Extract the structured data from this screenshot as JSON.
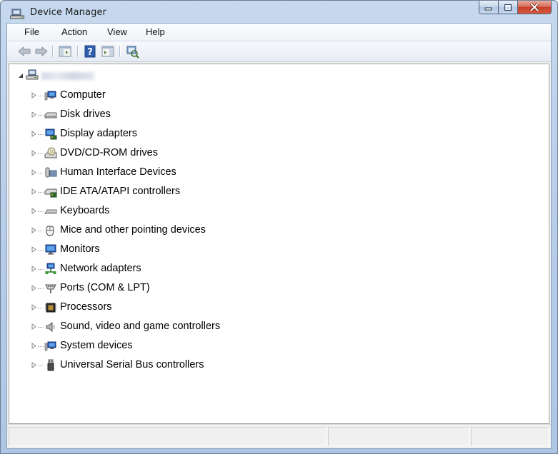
{
  "window": {
    "title": "Device Manager"
  },
  "menubar": [
    "File",
    "Action",
    "View",
    "Help"
  ],
  "toolbar": [
    "back-icon",
    "forward-icon",
    "show-hide-console-tree-icon",
    "help-icon",
    "properties-pane-icon",
    "scan-hardware-icon"
  ],
  "tree": {
    "root_label_obscured": true,
    "categories": [
      "Computer",
      "Disk drives",
      "Display adapters",
      "DVD/CD-ROM drives",
      "Human Interface Devices",
      "IDE ATA/ATAPI controllers",
      "Keyboards",
      "Mice and other pointing devices",
      "Monitors",
      "Network adapters",
      "Ports (COM & LPT)",
      "Processors",
      "Sound, video and game controllers",
      "System devices",
      "Universal Serial Bus controllers"
    ]
  },
  "status": {
    "panes": [
      "",
      "",
      ""
    ]
  },
  "colors": {
    "title_bar": "#b9cfea",
    "close_button": "#c4402a",
    "tree_background": "#ffffff"
  }
}
